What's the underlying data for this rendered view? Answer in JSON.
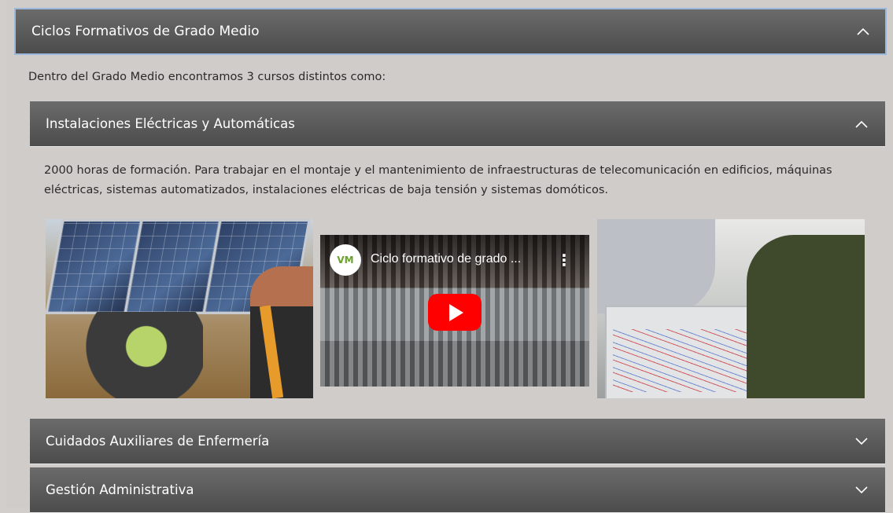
{
  "main_accordion": {
    "title": "Ciclos Formativos de Grado Medio",
    "expanded": true
  },
  "intro_text": "Dentro del Grado Medio encontramos 3 cursos distintos como:",
  "courses": [
    {
      "title": "Instalaciones Eléctricas y Automáticas",
      "expanded": true,
      "description": "2000 horas de formación. Para trabajar en el montaje y el mantenimiento de infraestructuras de telecomunicación en edificios, máquinas eléctricas, sistemas automatizados, instalaciones eléctricas de baja tensión y sistemas domóticos.",
      "video": {
        "title": "Ciclo formativo de grado ...",
        "channel_logo_text": "VM"
      }
    },
    {
      "title": "Cuidados Auxiliares de Enfermería",
      "expanded": false
    },
    {
      "title": "Gestión Administrativa",
      "expanded": false
    }
  ],
  "icons": {
    "expanded": "chevron-up-icon",
    "collapsed": "chevron-down-icon"
  }
}
